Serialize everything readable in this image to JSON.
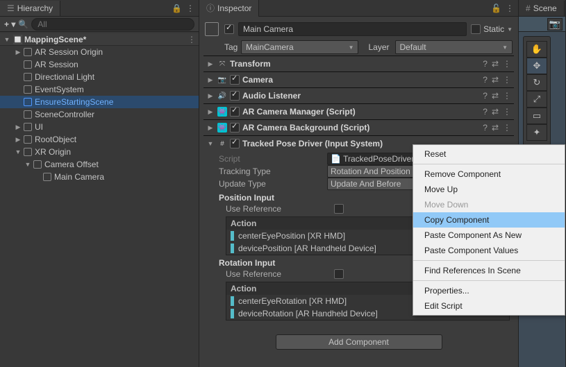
{
  "hierarchy": {
    "tab": "Hierarchy",
    "search_placeholder": "All",
    "scene": "MappingScene*",
    "items": [
      {
        "label": "AR Session Origin",
        "depth": 1,
        "fold": "▶",
        "dim": false
      },
      {
        "label": "AR Session",
        "depth": 1,
        "fold": "",
        "dim": false
      },
      {
        "label": "Directional Light",
        "depth": 1,
        "fold": "",
        "dim": false
      },
      {
        "label": "EventSystem",
        "depth": 1,
        "fold": "",
        "dim": false
      },
      {
        "label": "EnsureStartingScene",
        "depth": 1,
        "fold": "",
        "dim": false,
        "blue": true,
        "selected": true
      },
      {
        "label": "SceneController",
        "depth": 1,
        "fold": "",
        "dim": false
      },
      {
        "label": "UI",
        "depth": 1,
        "fold": "▶",
        "dim": false
      },
      {
        "label": "RootObject",
        "depth": 1,
        "fold": "▶",
        "dim": true
      },
      {
        "label": "XR Origin",
        "depth": 1,
        "fold": "▼",
        "dim": false
      },
      {
        "label": "Camera Offset",
        "depth": 2,
        "fold": "▼",
        "dim": false
      },
      {
        "label": "Main Camera",
        "depth": 3,
        "fold": "",
        "dim": false
      }
    ]
  },
  "inspector": {
    "tab": "Inspector",
    "name": "Main Camera",
    "static_label": "Static",
    "tag_label": "Tag",
    "tag_value": "MainCamera",
    "layer_label": "Layer",
    "layer_value": "Default",
    "components": [
      {
        "icon": "⤧",
        "icon_bg": "",
        "title": "Transform",
        "check": false
      },
      {
        "icon": "📷",
        "icon_bg": "",
        "title": "Camera",
        "check": true
      },
      {
        "icon": "🔊",
        "icon_bg": "",
        "title": "Audio Listener",
        "check": true
      },
      {
        "icon": "👾",
        "icon_bg": "#00c2d1",
        "title": "AR Camera Manager (Script)",
        "check": true
      },
      {
        "icon": "👾",
        "icon_bg": "#00c2d1",
        "title": "AR Camera Background (Script)",
        "check": true
      }
    ],
    "tracked": {
      "title": "Tracked Pose Driver (Input System)",
      "script_label": "Script",
      "script_value": "TrackedPoseDriver",
      "tracking_label": "Tracking Type",
      "tracking_value": "Rotation And Position",
      "update_label": "Update Type",
      "update_value": "Update And Before",
      "pos_header": "Position Input",
      "use_ref": "Use Reference",
      "action": "Action",
      "pos_actions": [
        "centerEyePosition [XR HMD]",
        "devicePosition [AR Handheld Device]"
      ],
      "rot_header": "Rotation Input",
      "rot_actions": [
        "centerEyeRotation [XR HMD]",
        "deviceRotation [AR Handheld Device]"
      ]
    },
    "add_component": "Add Component"
  },
  "scene": {
    "tab": "Scene"
  },
  "context": {
    "items": [
      {
        "label": "Reset",
        "sep_after": true
      },
      {
        "label": "Remove Component"
      },
      {
        "label": "Move Up"
      },
      {
        "label": "Move Down",
        "disabled": true
      },
      {
        "label": "Copy Component",
        "highlight": true
      },
      {
        "label": "Paste Component As New"
      },
      {
        "label": "Paste Component Values",
        "sep_after": true
      },
      {
        "label": "Find References In Scene",
        "sep_after": true
      },
      {
        "label": "Properties..."
      },
      {
        "label": "Edit Script"
      }
    ]
  }
}
